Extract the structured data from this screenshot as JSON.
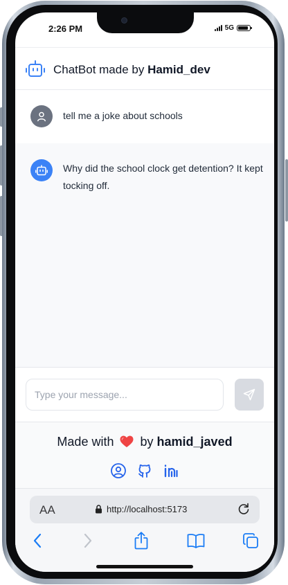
{
  "status": {
    "time": "2:26 PM",
    "network": "5G"
  },
  "header": {
    "icon": "robot-icon",
    "title_prefix": "ChatBot made by ",
    "title_author": "Hamid_dev"
  },
  "messages": [
    {
      "role": "user",
      "avatar_icon": "user-icon",
      "text": "tell me a joke about schools"
    },
    {
      "role": "bot",
      "avatar_icon": "robot-icon",
      "text": "Why did the school clock get detention? It kept tocking off."
    }
  ],
  "composer": {
    "placeholder": "Type your message...",
    "value": "",
    "send_icon": "send-icon"
  },
  "footer": {
    "made_with": "Made with",
    "heart_icon": "heart-icon",
    "by": "by",
    "author": "hamid_javed",
    "social_icons": [
      "user-circle-icon",
      "github-icon",
      "linkedin-icon"
    ]
  },
  "browser": {
    "aa_label": "AA",
    "url": "http://localhost:5173",
    "lock_icon": "lock-icon",
    "reload_icon": "reload-icon",
    "toolbar_icons": [
      "back-icon",
      "forward-icon",
      "share-icon",
      "bookmarks-icon",
      "tabs-icon"
    ]
  },
  "colors": {
    "accent": "#3b82f6",
    "user_avatar": "#6b7280",
    "heart": "#ef4444",
    "send_disabled": "#d8dbe1",
    "safari_blue": "#1a7cf5"
  }
}
